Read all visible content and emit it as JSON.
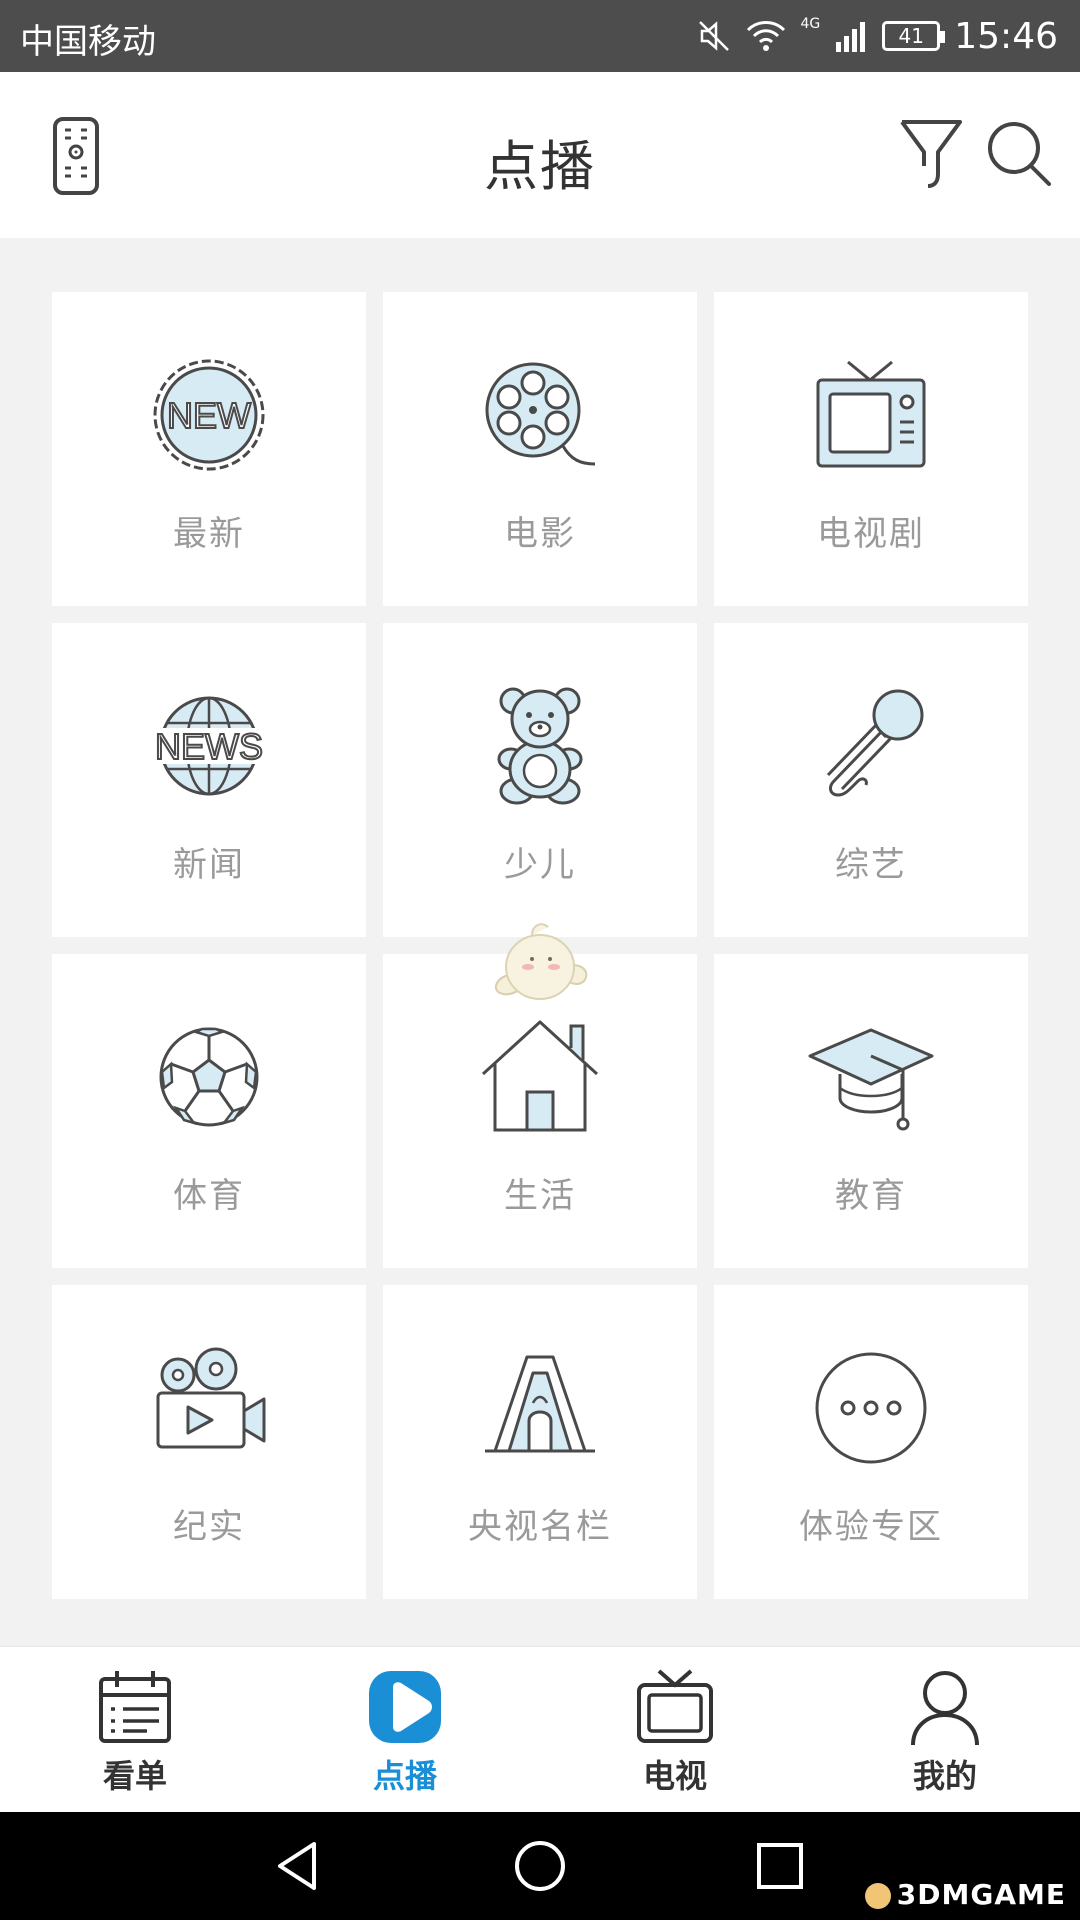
{
  "status_bar": {
    "carrier": "中国移动",
    "network": "4G",
    "battery": "41",
    "time": "15:46"
  },
  "header": {
    "title": "点播",
    "icons": [
      "remote-control-icon",
      "filter-icon",
      "search-icon"
    ]
  },
  "categories": [
    {
      "label": "最新",
      "icon": "new-badge-icon"
    },
    {
      "label": "电影",
      "icon": "film-reel-icon"
    },
    {
      "label": "电视剧",
      "icon": "tv-set-icon"
    },
    {
      "label": "新闻",
      "icon": "news-globe-icon"
    },
    {
      "label": "少儿",
      "icon": "teddy-bear-icon"
    },
    {
      "label": "综艺",
      "icon": "microphone-icon"
    },
    {
      "label": "体育",
      "icon": "soccer-ball-icon"
    },
    {
      "label": "生活",
      "icon": "house-icon"
    },
    {
      "label": "教育",
      "icon": "graduation-cap-icon"
    },
    {
      "label": "纪实",
      "icon": "movie-camera-icon"
    },
    {
      "label": "央视名栏",
      "icon": "cctv-building-icon"
    },
    {
      "label": "体验专区",
      "icon": "more-dots-icon"
    }
  ],
  "icon_text": {
    "new": "NEW",
    "news": "NEWS"
  },
  "tabbar": {
    "items": [
      {
        "label": "看单",
        "icon": "calendar-list-icon",
        "active": false
      },
      {
        "label": "点播",
        "icon": "play-icon",
        "active": true
      },
      {
        "label": "电视",
        "icon": "tv-icon",
        "active": false
      },
      {
        "label": "我的",
        "icon": "user-icon",
        "active": false
      }
    ]
  },
  "colors": {
    "accent": "#1a8fd6",
    "icon_fill": "#d7ebf5",
    "icon_stroke": "#4a4a4a",
    "label": "#9a9a9a",
    "status_bar": "#4d4d4d"
  },
  "watermark": "3DMGAME"
}
